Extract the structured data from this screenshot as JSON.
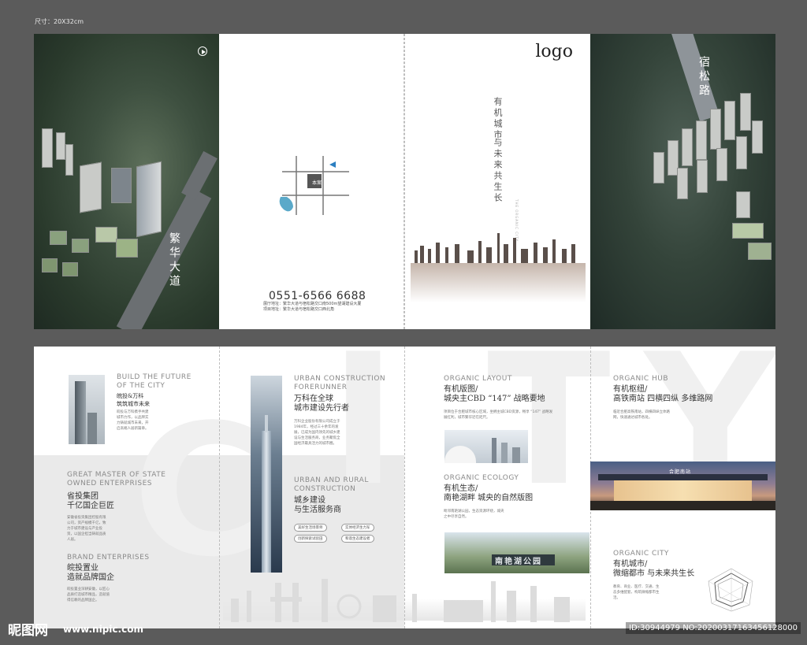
{
  "size_label": "尺寸：20X32cm",
  "top": {
    "left_panel": {
      "road_label": "繁华大道"
    },
    "contact_panel": {
      "map_label": "本案",
      "phone": "0551-6566 6688",
      "address_1": "展厅地址：繁华大道与宿松路交口南500m望湖建设大厦",
      "address_2": "项目地址：繁华大道与宿松路交口西北角"
    },
    "cover_panel": {
      "logo": "logo",
      "slogan_1": "有机城市",
      "slogan_2": "与未来共生长",
      "slogan_en": "THE ORGANIC CITY"
    },
    "right_panel": {
      "road_label": "宿松路"
    }
  },
  "bottom": {
    "watermark_letters": [
      "C",
      "I",
      "T",
      "Y"
    ],
    "col1": {
      "s1_en": "BUILD THE FUTURE OF THE CITY",
      "s1_cn_1": "皖投&万科",
      "s1_cn_2": "筑筑城市未来",
      "s1_body": "皖投与万科携手共建城市力作，以品牌实力铸就城市未来，开启高端人居新篇章。",
      "s2_en": "GREAT MASTER OF STATE OWNED ENTERPRISES",
      "s2_cn_1": "省投集团",
      "s2_cn_2": "千亿国企巨匠",
      "s2_body": "安徽省投资集团控股有限公司，资产规模千亿，致力于城市建设与产业投资，以国企担当铸就品质人居。",
      "s3_en": "BRAND ENTERPRISES",
      "s3_cn_1": "皖投置业",
      "s3_cn_2": "造就品牌国企",
      "s3_body": "皖投置业深耕安徽，以匠心品质打造城市精品，造就值得信赖的品牌国企。"
    },
    "col2": {
      "s1_en": "URBAN CONSTRUCTION FORERUNNER",
      "s1_cn_1": "万科在全球",
      "s1_cn_2": "城市建设先行者",
      "s1_body": "万科企业股份有限公司成立于1984年，经过三十余年的发展，已成为国内领先的城乡建设与生活服务商，业务聚焦全国经济最具活力的城市圈。",
      "s2_en": "URBAN AND RURAL CONSTRUCTION",
      "s2_cn_1": "城乡建设",
      "s2_cn_2": "与生活服务商",
      "pills": [
        "美好生活场景师",
        "实体经济生力军",
        "创新探索试验田",
        "和谐生态建设者"
      ]
    },
    "col3": {
      "s1_en": "ORGANIC LAYOUT",
      "s1_cn_1": "有机版图/",
      "s1_cn_2": "城央主CBD “147” 战略要地",
      "s1_body": "项目位于合肥城市核心区域，坐拥主城CBD资源，畅享 “147” 战略发展红利，城市繁华近在咫尺。",
      "s2_en": "ORGANIC ECOLOGY",
      "s2_cn_1": "有机生态/",
      "s2_cn_2": "南艳湖畔 城央的自然版图",
      "s2_body": "毗邻南艳湖公园，生态资源环绕，城央之中尽享自然。",
      "park_sign": "南艳湖公园"
    },
    "col4": {
      "s1_en": "ORGANIC HUB",
      "s1_cn_1": "有机枢纽/",
      "s1_cn_2": "高铁南站 四横四纵 多维路网",
      "s1_body": "临近合肥高铁南站，四横四纵立体路网，快速通达城市各处。",
      "station_sign": "合肥南站",
      "s2_en": "ORGANIC CITY",
      "s2_cn_1": "有机城市/",
      "s2_cn_2": "微缩都市 与未来共生长",
      "s2_body": "教育、商业、医疗、交通、生态多维配套，构筑微缩都市生活。"
    }
  },
  "watermark": {
    "brand": "昵图网",
    "url": "www.nipic.com",
    "id": "ID:30944979 NO:20200317163456128000"
  }
}
